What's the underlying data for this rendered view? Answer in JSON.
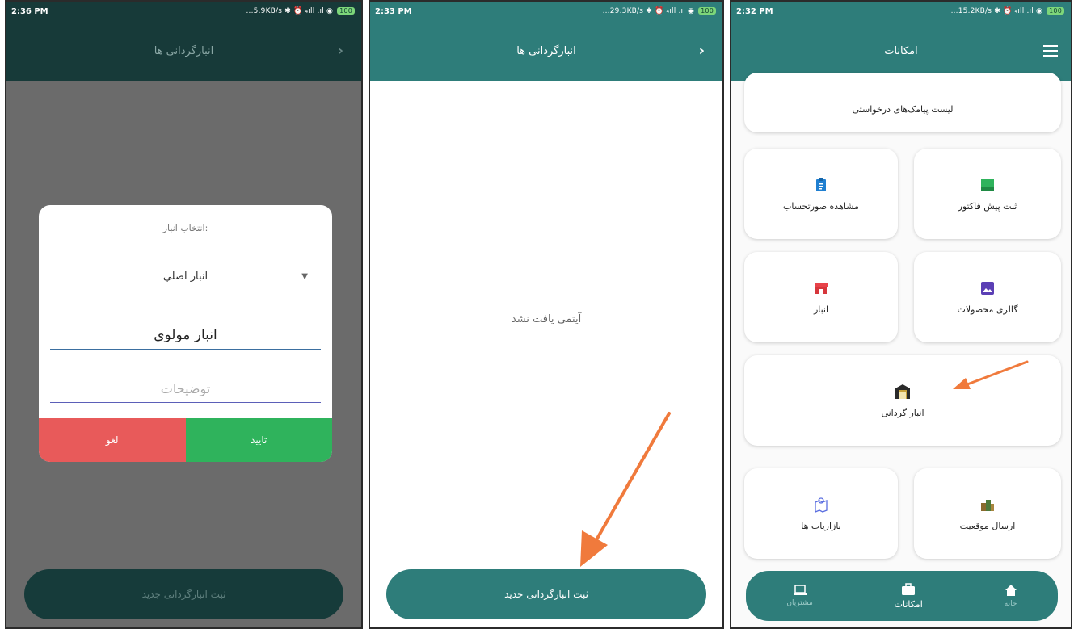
{
  "phone1": {
    "status": {
      "time": "2:36 PM",
      "right": "...5.9KB/s ✱ ⏰ ₄ıll .ıl ◉",
      "battery": "100"
    },
    "appbar_title": "انبارگردانی ها",
    "dialog": {
      "title": "انتخاب انبار:",
      "selected_warehouse": "انبار اصلي",
      "name_value": "انبار مولوی",
      "description_placeholder": "توضیحات",
      "cancel_label": "لغو",
      "confirm_label": "تایید"
    },
    "bottom_button": "ثبت انبارگردانی جدید"
  },
  "phone2": {
    "status": {
      "time": "2:33 PM",
      "right": "...29.3KB/s ✱ ⏰ ₄ıll .ıl ◉",
      "battery": "100"
    },
    "appbar_title": "انبارگردانی ها",
    "empty_message": "آیتمی یافت نشد",
    "primary_button": "ثبت انبارگردانی جدید"
  },
  "phone3": {
    "status": {
      "time": "2:32 PM",
      "right": "...15.2KB/s ✱ ⏰ ₄ıll .ıl ◉",
      "battery": "100"
    },
    "appbar_title": "امکانات",
    "cards": {
      "sms_requests": "لیست پیامک‌های درخواستی",
      "view_statement": "مشاهده صورتحساب",
      "proforma": "ثبت پیش فاکتور",
      "warehouse": "انبار",
      "gallery": "گالری محصولات",
      "stocktaking": "انبار گردانی",
      "marketers": "بازاریاب ها",
      "send_location": "ارسال موقعیت"
    },
    "bottom_nav": {
      "left": "مشتریان",
      "center": "امکانات",
      "right": "خانه"
    }
  },
  "colors": {
    "primary": "#2e7d7a",
    "confirm": "#2fb35c",
    "cancel": "#e85a5a",
    "arrow": "#f07a3c"
  }
}
